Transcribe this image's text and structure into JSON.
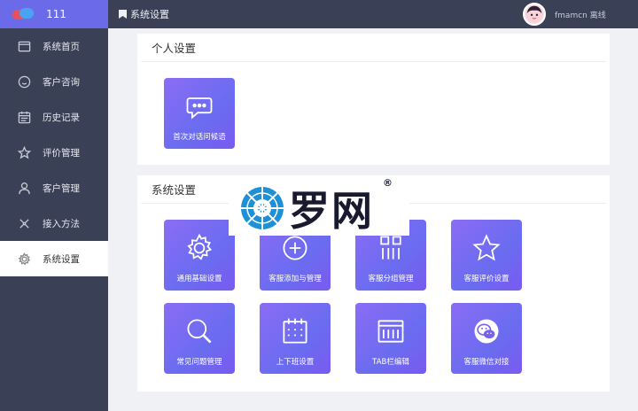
{
  "sidebar": {
    "badge": "111",
    "items": [
      {
        "label": "系统首页",
        "icon": "window-icon"
      },
      {
        "label": "客户咨询",
        "icon": "chat-face-icon"
      },
      {
        "label": "历史记录",
        "icon": "calendar-icon"
      },
      {
        "label": "评价管理",
        "icon": "star-icon"
      },
      {
        "label": "客户管理",
        "icon": "user-icon"
      },
      {
        "label": "接入方法",
        "icon": "link-icon"
      },
      {
        "label": "系统设置",
        "icon": "gear-icon",
        "active": true
      }
    ]
  },
  "topbar": {
    "title": "系统设置",
    "user_name": "fmamcn",
    "user_status": "离线"
  },
  "personal": {
    "title": "个人设置",
    "tiles": [
      {
        "label": "首次对话问候语",
        "icon": "chat-bubble-icon"
      }
    ]
  },
  "system": {
    "title": "系统设置",
    "tiles": [
      {
        "label": "通用基础设置",
        "icon": "gear-icon"
      },
      {
        "label": "客服添加与管理",
        "icon": "plus-circle-icon"
      },
      {
        "label": "客服分组管理",
        "icon": "grid-icon"
      },
      {
        "label": "客服评价设置",
        "icon": "star-icon"
      },
      {
        "label": "常见问题管理",
        "icon": "search-icon"
      },
      {
        "label": "上下班设置",
        "icon": "calendar-icon"
      },
      {
        "label": "TAB栏编辑",
        "icon": "browser-window-icon"
      },
      {
        "label": "客服微信对接",
        "icon": "wechat-icon"
      }
    ]
  },
  "watermark": {
    "text": "罗网",
    "reg": "®"
  },
  "colors": {
    "sidebar_bg": "#3a4055",
    "sidebar_top": "#6b6ae8",
    "tile_gradient_start": "#8b6cf5",
    "tile_gradient_end": "#6a6cf0"
  }
}
